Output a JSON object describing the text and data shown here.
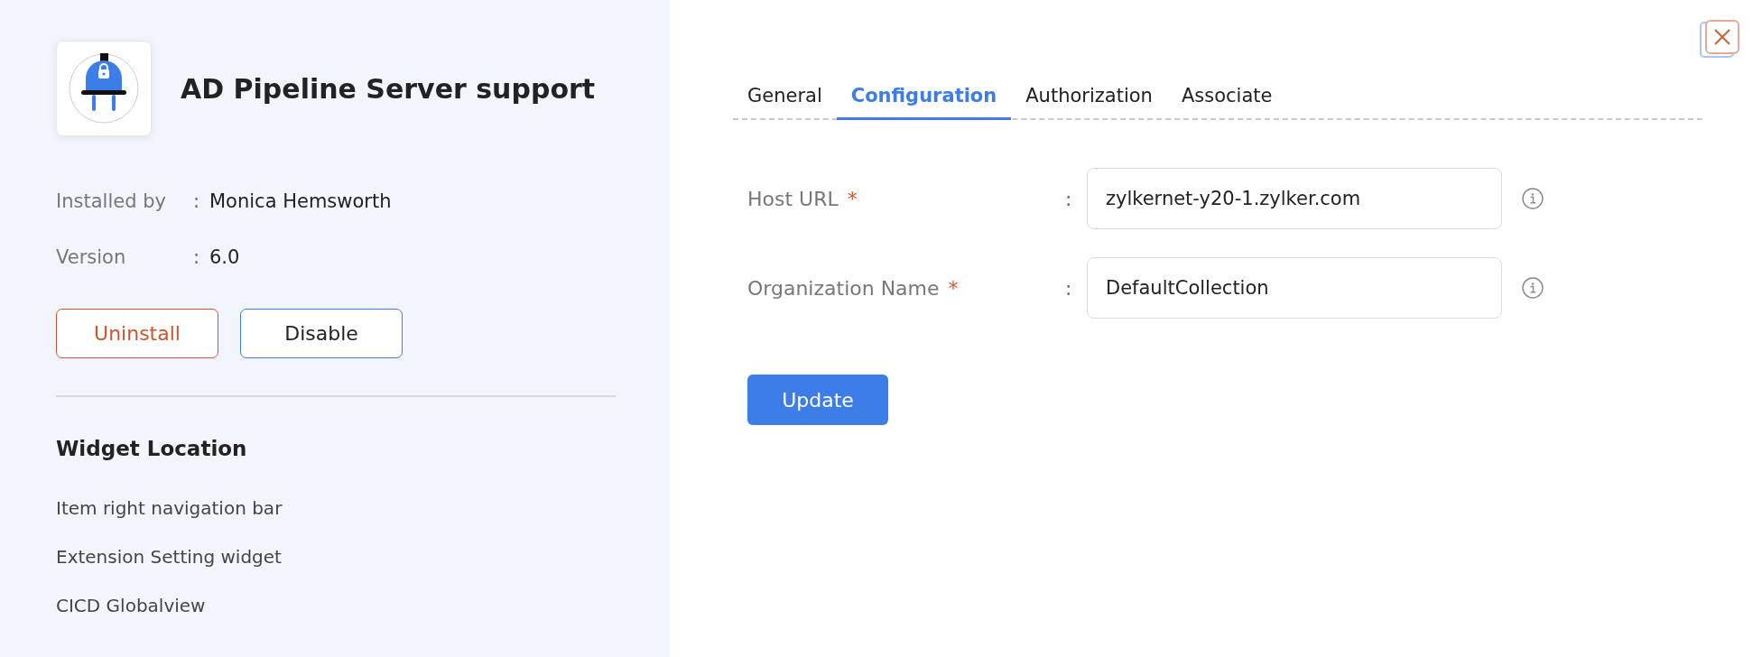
{
  "extension": {
    "name": "AD Pipeline Server support"
  },
  "details": [
    {
      "label": "Installed by",
      "separator": ":",
      "value": "Monica Hemsworth"
    },
    {
      "label": "Version",
      "separator": ":",
      "value": "6.0"
    }
  ],
  "actions": [
    {
      "kind": "danger",
      "label": "Uninstall"
    },
    {
      "kind": "outline",
      "label": "Disable"
    }
  ],
  "widget_location": {
    "title": "Widget Location",
    "items": [
      "Item right navigation bar",
      "Extension Setting widget",
      "CICD Globalview"
    ]
  },
  "tabs": [
    {
      "label": "General",
      "selected": false
    },
    {
      "label": "Configuration",
      "selected": true
    },
    {
      "label": "Authorization",
      "selected": false
    },
    {
      "label": "Associate",
      "selected": false
    }
  ],
  "fields": [
    {
      "label": "Host URL",
      "required_mark": "*",
      "separator": ":",
      "value": "zylkernet-y20-1.zylker.com"
    },
    {
      "label": "Organization Name",
      "required_mark": "*",
      "separator": ":",
      "value": "DefaultCollection"
    }
  ],
  "submit": {
    "label": "Update"
  }
}
